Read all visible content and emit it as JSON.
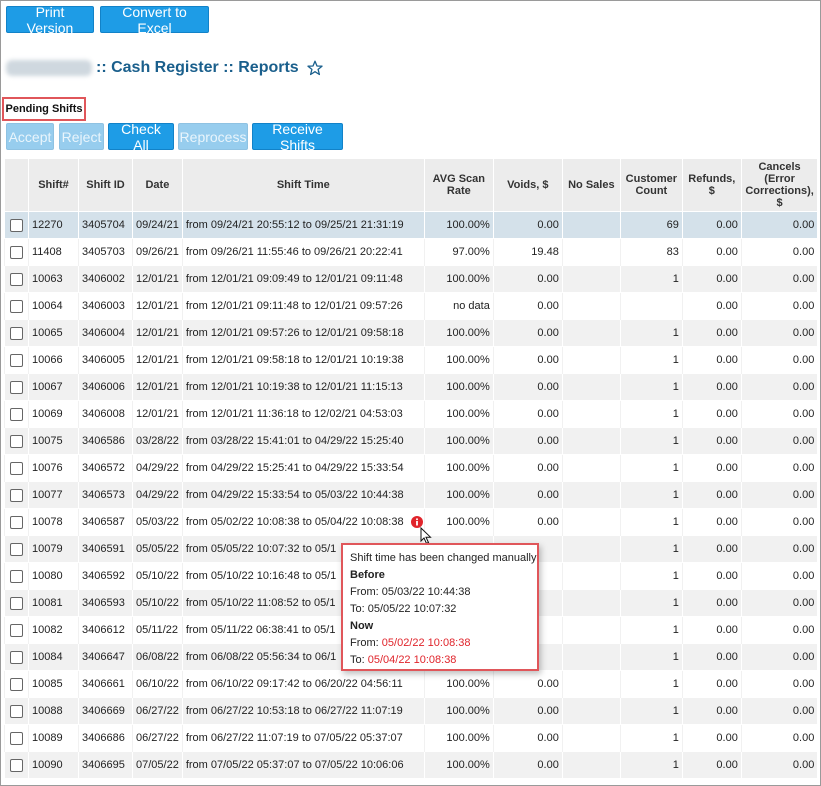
{
  "toolbar": {
    "print_label": "Print Version",
    "excel_label": "Convert to Excel"
  },
  "title": ":: Cash Register :: Reports",
  "pending_label": "Pending Shifts",
  "actions": {
    "accept": "Accept",
    "reject": "Reject",
    "check_all": "Check All",
    "reprocess": "Reprocess",
    "receive": "Receive Shifts"
  },
  "columns": [
    "Shift#",
    "Shift ID",
    "Date",
    "Shift Time",
    "AVG Scan Rate",
    "Voids, $",
    "No Sales",
    "Customer Count",
    "Refunds, $",
    "Cancels (Error Corrections), $"
  ],
  "rows": [
    {
      "shift": "12270",
      "id": "3405704",
      "date": "09/24/21",
      "time": "from 09/24/21 20:55:12 to 09/25/21 21:31:19",
      "avg": "100.00%",
      "voids": "0.00",
      "nosales": "",
      "count": "69",
      "refunds": "0.00",
      "cancels": "0.00"
    },
    {
      "shift": "11408",
      "id": "3405703",
      "date": "09/26/21",
      "time": "from 09/26/21 11:55:46 to 09/26/21 20:22:41",
      "avg": "97.00%",
      "voids": "19.48",
      "nosales": "",
      "count": "83",
      "refunds": "0.00",
      "cancels": "0.00"
    },
    {
      "shift": "10063",
      "id": "3406002",
      "date": "12/01/21",
      "time": "from 12/01/21 09:09:49 to 12/01/21 09:11:48",
      "avg": "100.00%",
      "voids": "0.00",
      "nosales": "",
      "count": "1",
      "refunds": "0.00",
      "cancels": "0.00"
    },
    {
      "shift": "10064",
      "id": "3406003",
      "date": "12/01/21",
      "time": "from 12/01/21 09:11:48 to 12/01/21 09:57:26",
      "avg": "no data",
      "voids": "0.00",
      "nosales": "",
      "count": "",
      "refunds": "0.00",
      "cancels": "0.00"
    },
    {
      "shift": "10065",
      "id": "3406004",
      "date": "12/01/21",
      "time": "from 12/01/21 09:57:26 to 12/01/21 09:58:18",
      "avg": "100.00%",
      "voids": "0.00",
      "nosales": "",
      "count": "1",
      "refunds": "0.00",
      "cancels": "0.00"
    },
    {
      "shift": "10066",
      "id": "3406005",
      "date": "12/01/21",
      "time": "from 12/01/21 09:58:18 to 12/01/21 10:19:38",
      "avg": "100.00%",
      "voids": "0.00",
      "nosales": "",
      "count": "1",
      "refunds": "0.00",
      "cancels": "0.00"
    },
    {
      "shift": "10067",
      "id": "3406006",
      "date": "12/01/21",
      "time": "from 12/01/21 10:19:38 to 12/01/21 11:15:13",
      "avg": "100.00%",
      "voids": "0.00",
      "nosales": "",
      "count": "1",
      "refunds": "0.00",
      "cancels": "0.00"
    },
    {
      "shift": "10069",
      "id": "3406008",
      "date": "12/01/21",
      "time": "from 12/01/21 11:36:18 to 12/02/21 04:53:03",
      "avg": "100.00%",
      "voids": "0.00",
      "nosales": "",
      "count": "1",
      "refunds": "0.00",
      "cancels": "0.00"
    },
    {
      "shift": "10075",
      "id": "3406586",
      "date": "03/28/22",
      "time": "from 03/28/22 15:41:01 to 04/29/22 15:25:40",
      "avg": "100.00%",
      "voids": "0.00",
      "nosales": "",
      "count": "1",
      "refunds": "0.00",
      "cancels": "0.00"
    },
    {
      "shift": "10076",
      "id": "3406572",
      "date": "04/29/22",
      "time": "from 04/29/22 15:25:41 to 04/29/22 15:33:54",
      "avg": "100.00%",
      "voids": "0.00",
      "nosales": "",
      "count": "1",
      "refunds": "0.00",
      "cancels": "0.00"
    },
    {
      "shift": "10077",
      "id": "3406573",
      "date": "04/29/22",
      "time": "from 04/29/22 15:33:54 to 05/03/22 10:44:38",
      "avg": "100.00%",
      "voids": "0.00",
      "nosales": "",
      "count": "1",
      "refunds": "0.00",
      "cancels": "0.00"
    },
    {
      "shift": "10078",
      "id": "3406587",
      "date": "05/03/22",
      "time": "from 05/02/22 10:08:38 to 05/04/22 10:08:38",
      "avg": "100.00%",
      "voids": "0.00",
      "nosales": "",
      "count": "1",
      "refunds": "0.00",
      "cancels": "0.00"
    },
    {
      "shift": "10079",
      "id": "3406591",
      "date": "05/05/22",
      "time": "from 05/05/22 10:07:32 to 05/1",
      "avg": "",
      "voids": "",
      "nosales": "",
      "count": "1",
      "refunds": "0.00",
      "cancels": "0.00"
    },
    {
      "shift": "10080",
      "id": "3406592",
      "date": "05/10/22",
      "time": "from 05/10/22 10:16:48 to 05/1",
      "avg": "",
      "voids": "",
      "nosales": "",
      "count": "1",
      "refunds": "0.00",
      "cancels": "0.00"
    },
    {
      "shift": "10081",
      "id": "3406593",
      "date": "05/10/22",
      "time": "from 05/10/22 11:08:52 to 05/1",
      "avg": "",
      "voids": "",
      "nosales": "",
      "count": "1",
      "refunds": "0.00",
      "cancels": "0.00"
    },
    {
      "shift": "10082",
      "id": "3406612",
      "date": "05/11/22",
      "time": "from 05/11/22 06:38:41 to 05/1",
      "avg": "",
      "voids": "",
      "nosales": "",
      "count": "1",
      "refunds": "0.00",
      "cancels": "0.00"
    },
    {
      "shift": "10084",
      "id": "3406647",
      "date": "06/08/22",
      "time": "from 06/08/22 05:56:34 to 06/1",
      "avg": "",
      "voids": "",
      "nosales": "",
      "count": "1",
      "refunds": "0.00",
      "cancels": "0.00"
    },
    {
      "shift": "10085",
      "id": "3406661",
      "date": "06/10/22",
      "time": "from 06/10/22 09:17:42 to 06/20/22 04:56:11",
      "avg": "100.00%",
      "voids": "0.00",
      "nosales": "",
      "count": "1",
      "refunds": "0.00",
      "cancels": "0.00"
    },
    {
      "shift": "10088",
      "id": "3406669",
      "date": "06/27/22",
      "time": "from 06/27/22 10:53:18 to 06/27/22 11:07:19",
      "avg": "100.00%",
      "voids": "0.00",
      "nosales": "",
      "count": "1",
      "refunds": "0.00",
      "cancels": "0.00"
    },
    {
      "shift": "10089",
      "id": "3406686",
      "date": "06/27/22",
      "time": "from 06/27/22 11:07:19 to 07/05/22 05:37:07",
      "avg": "100.00%",
      "voids": "0.00",
      "nosales": "",
      "count": "1",
      "refunds": "0.00",
      "cancels": "0.00"
    },
    {
      "shift": "10090",
      "id": "3406695",
      "date": "07/05/22",
      "time": "from 07/05/22 05:37:07 to 07/05/22 10:06:06",
      "avg": "100.00%",
      "voids": "0.00",
      "nosales": "",
      "count": "1",
      "refunds": "0.00",
      "cancels": "0.00"
    }
  ],
  "tooltip": {
    "heading": "Shift time has been changed manually",
    "before_label": "Before",
    "before_from": "From: 05/03/22 10:44:38",
    "before_to": "To: 05/05/22 10:07:32",
    "now_label": "Now",
    "now_from_prefix": "From: ",
    "now_from_value": "05/02/22 10:08:38",
    "now_to_prefix": "To: ",
    "now_to_value": "05/04/22 10:08:38"
  },
  "colors": {
    "button": "#1e9ce6",
    "title": "#1a5f8c",
    "highlight_border": "#e0565a",
    "changed_value": "#e0242b"
  },
  "icons": [
    "star-icon",
    "info-icon",
    "cursor-pointer-icon",
    "checkbox-icon"
  ]
}
